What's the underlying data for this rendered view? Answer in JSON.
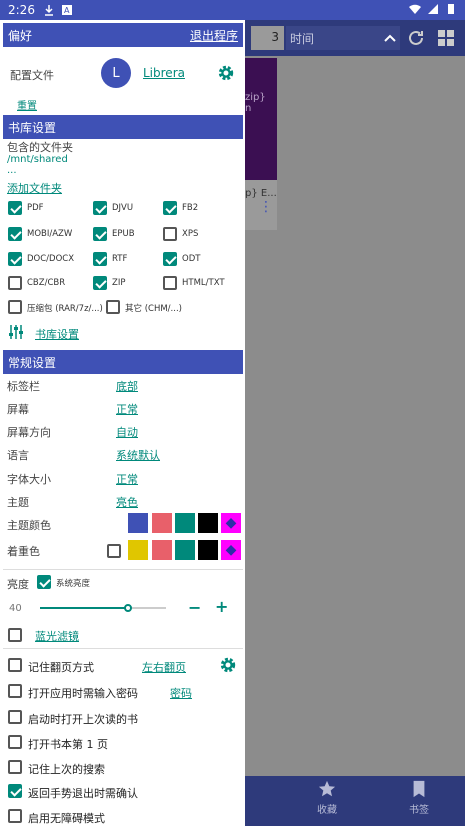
{
  "status": {
    "time": "2:26"
  },
  "background": {
    "count": "3",
    "sort_label": "时间",
    "card_text": "zip}",
    "card_sub": "n",
    "card_label": "p} E...",
    "tabs": [
      {
        "label": "收藏",
        "icon": "star-icon"
      },
      {
        "label": "书签",
        "icon": "bookmark-icon"
      }
    ]
  },
  "drawer": {
    "title": "偏好",
    "exit": "退出程序",
    "profile_label": "配置文件",
    "avatar_letter": "L",
    "profile_name": "Librera",
    "reset": "重置",
    "library_header": "书库设置",
    "folders_label": "包含的文件夹",
    "folder_path": "/mnt/shared",
    "ellipsis": "...",
    "add_folder": "添加文件夹",
    "formats": [
      {
        "label": "PDF",
        "checked": true
      },
      {
        "label": "DJVU",
        "checked": true
      },
      {
        "label": "FB2",
        "checked": true
      },
      {
        "label": "MOBI/AZW",
        "checked": true
      },
      {
        "label": "EPUB",
        "checked": true
      },
      {
        "label": "XPS",
        "checked": false
      },
      {
        "label": "DOC/DOCX",
        "checked": true
      },
      {
        "label": "RTF",
        "checked": true
      },
      {
        "label": "ODT",
        "checked": true
      },
      {
        "label": "CBZ/CBR",
        "checked": false
      },
      {
        "label": "ZIP",
        "checked": true
      },
      {
        "label": "HTML/TXT",
        "checked": false
      },
      {
        "label": "压缩包 (RAR/7z/...)",
        "checked": false
      },
      {
        "label": "其它 (CHM/...)",
        "checked": false
      }
    ],
    "library_settings_link": "书库设置",
    "general_header": "常规设置",
    "general": [
      {
        "label": "标签栏",
        "value": "底部"
      },
      {
        "label": "屏幕",
        "value": "正常"
      },
      {
        "label": "屏幕方向",
        "value": "自动"
      },
      {
        "label": "语言",
        "value": "系统默认"
      },
      {
        "label": "字体大小",
        "value": "正常"
      },
      {
        "label": "主题",
        "value": "亮色"
      }
    ],
    "theme_color_label": "主题颜色",
    "theme_colors": [
      "#3f51b5",
      "#e8606a",
      "#00897b",
      "#000000",
      "#ff00ff"
    ],
    "accent_label": "着重色",
    "accent_colors": [
      "#e0c600",
      "#e8606a",
      "#00897b",
      "#000000",
      "#ff00ff"
    ],
    "brightness_label": "亮度",
    "brightness_system": "系统亮度",
    "brightness_value": "40",
    "brightness_level": 0.7,
    "minus": "−",
    "plus": "+",
    "blue_filter": "蓝光滤镜",
    "options": [
      {
        "label": "记住翻页方式",
        "checked": false,
        "link": "左右翻页"
      },
      {
        "label": "打开应用时需输入密码",
        "checked": false,
        "link": "密码"
      },
      {
        "label": "启动时打开上次读的书",
        "checked": false
      },
      {
        "label": "打开书本第 1 页",
        "checked": false
      },
      {
        "label": "记住上次的搜索",
        "checked": false
      },
      {
        "label": "返回手势退出时需确认",
        "checked": true
      },
      {
        "label": "启用无障碍模式",
        "checked": false
      }
    ]
  }
}
